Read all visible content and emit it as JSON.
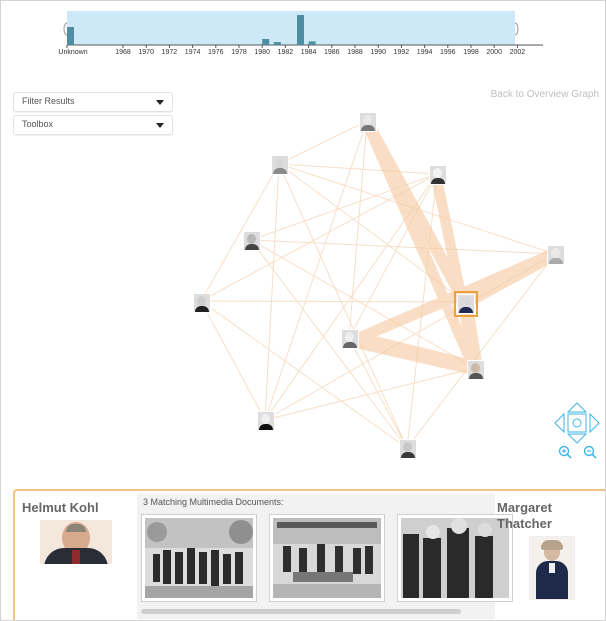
{
  "timeline": {
    "labels": [
      "Unknown",
      "1968",
      "1970",
      "1972",
      "1974",
      "1976",
      "1978",
      "1980",
      "1982",
      "1984",
      "1986",
      "1988",
      "1990",
      "1992",
      "1994",
      "1996",
      "1998",
      "2000",
      "2002"
    ],
    "bar_values": {
      "Unknown": 3,
      "1980": 1,
      "1981": 0.5,
      "1983": 5,
      "1984": 0.6
    },
    "accent": "#cde9f7",
    "bar_color": "#4d8ea3"
  },
  "controls": {
    "filter_label": "Filter Results",
    "toolbox_label": "Toolbox",
    "back_link": "Back to Overview Graph"
  },
  "graph": {
    "edge_color": "#f5c79a",
    "selected_color": "#e8a33c"
  },
  "bottom": {
    "left_person": "Helmut Kohl",
    "right_person_line1": "Margaret",
    "right_person_line2": "Thatcher",
    "documents_title": "3 Matching Multimedia Documents:"
  },
  "icons": {
    "zoom_in": "zoom-in-icon",
    "zoom_out": "zoom-out-icon",
    "pan": "pan-arrows-icon"
  }
}
